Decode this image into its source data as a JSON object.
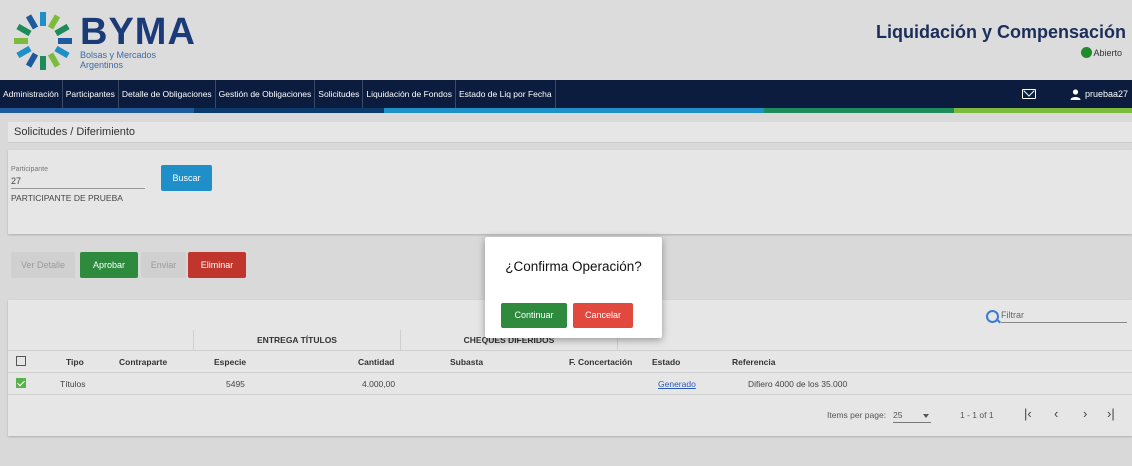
{
  "header": {
    "brand_name": "BYMA",
    "brand_sub_1": "Bolsas y Mercados",
    "brand_sub_2": "Argentinos",
    "app_title": "Liquidación y Compensación",
    "status_label": "Abierto",
    "status_color": "#1e8c2a"
  },
  "nav": {
    "items": [
      "Administración",
      "Participantes",
      "Detalle de Obligaciones",
      "Gestión de Obligaciones",
      "Solicitudes",
      "Liquidación de Fondos",
      "Estado de Liq por Fecha"
    ],
    "user": "pruebaa27",
    "stripe_colors": [
      "#1f5a9e",
      "#0b3a6c",
      "#1f8fc8",
      "#1e8c5a",
      "#7dbb3c"
    ]
  },
  "breadcrumb": "Solicitudes / Diferimiento",
  "filter": {
    "field_label": "Participante",
    "field_value": "27",
    "field_hint": "PARTICIPANTE DE PRUEBA",
    "search_button": "Buscar"
  },
  "actions": {
    "ver_detalle": "Ver Detalle",
    "aprobar": "Aprobar",
    "enviar": "Enviar",
    "eliminar": "Eliminar"
  },
  "table": {
    "filter_placeholder": "Filtrar",
    "group_entrega": "ENTREGA TÍTULOS",
    "group_cheques": "CHEQUES DIFERIDOS",
    "columns": {
      "tipo": "Tipo",
      "contraparte": "Contraparte",
      "especie": "Especie",
      "cantidad": "Cantidad",
      "subasta": "Subasta",
      "f_concertacion": "F. Concertación",
      "estado": "Estado",
      "referencia": "Referencia"
    },
    "rows": [
      {
        "tipo": "Títulos",
        "contraparte": "",
        "especie": "5495",
        "cantidad": "4.000,00",
        "subasta": "",
        "f_concertacion": "",
        "estado": "Generado",
        "referencia": "Difiero 4000 de los 35.000"
      }
    ]
  },
  "pagination": {
    "items_label": "Items per page:",
    "page_size": "25",
    "range": "1 - 1 of 1"
  },
  "dialog": {
    "title": "¿Confirma Operación?",
    "confirm": "Continuar",
    "cancel": "Cancelar"
  }
}
